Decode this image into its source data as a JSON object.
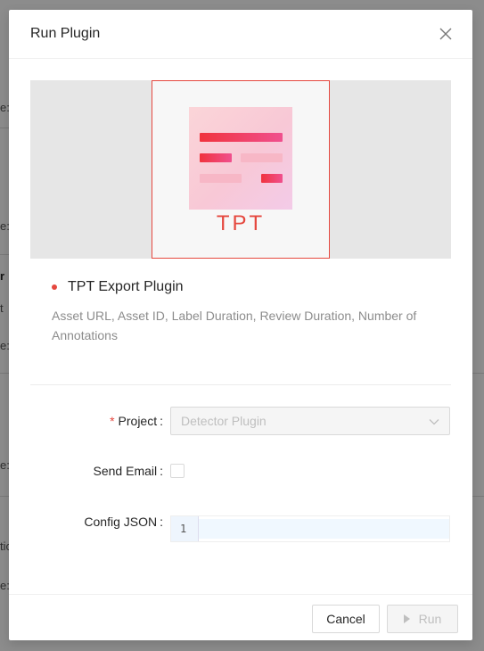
{
  "background": {
    "fragments": [
      "e:",
      "e:",
      "r",
      "t",
      "e:",
      "e:",
      "tic",
      "e:"
    ]
  },
  "modal": {
    "title": "Run Plugin",
    "close_icon": "close-icon"
  },
  "preview": {
    "logo_text": "TPT",
    "accent_color": "#e5483f"
  },
  "plugin": {
    "name": "TPT Export Plugin",
    "description": "Asset URL, Asset ID, Label Duration, Review Duration, Number of Annotations"
  },
  "form": {
    "project": {
      "required_mark": "*",
      "label": "Project",
      "colon": ":",
      "value": "Detector Plugin"
    },
    "send_email": {
      "label": "Send Email",
      "colon": ":",
      "checked": false
    },
    "config_json": {
      "label": "Config JSON",
      "colon": ":",
      "line_number": "1",
      "content": ""
    }
  },
  "footer": {
    "cancel_label": "Cancel",
    "run_label": "Run"
  }
}
